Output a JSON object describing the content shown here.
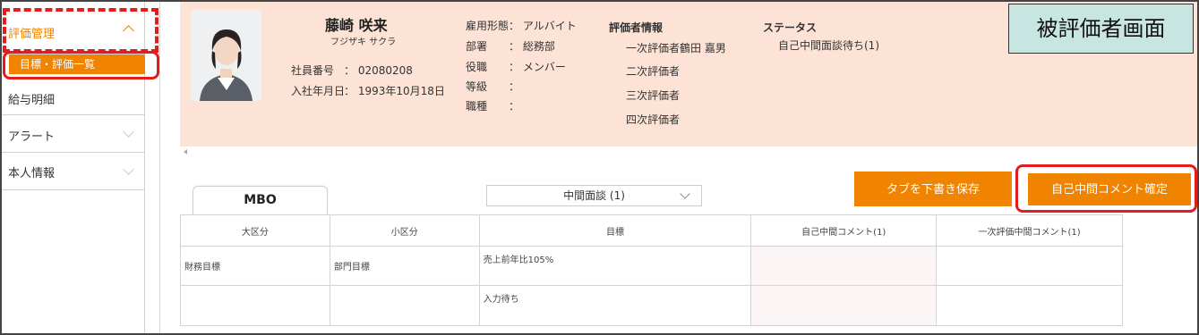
{
  "sidebar": {
    "items": [
      {
        "label": "評価管理"
      },
      {
        "label": "給与明細"
      },
      {
        "label": "アラート"
      },
      {
        "label": "本人情報"
      }
    ],
    "active_sub": "目標・評価一覧"
  },
  "profile": {
    "name": "藤崎 咲来",
    "kana": "フジザキ サクラ",
    "employee_number_label": "社員番号",
    "employee_number": "： 02080208",
    "hire_date_label": "入社年月日",
    "hire_date": "： 1993年10月18日",
    "details": [
      {
        "label": "雇用形態",
        "value": "： アルバイト"
      },
      {
        "label": "部署",
        "value": "： 総務部"
      },
      {
        "label": "役職",
        "value": "： メンバー"
      },
      {
        "label": "等級",
        "value": "："
      },
      {
        "label": "職種",
        "value": "："
      }
    ]
  },
  "evaluators": {
    "title": "評価者情報",
    "items": [
      {
        "label": "一次評価者",
        "value": "鶴田 嘉男"
      },
      {
        "label": "二次評価者",
        "value": ""
      },
      {
        "label": "三次評価者",
        "value": ""
      },
      {
        "label": "四次評価者",
        "value": ""
      }
    ]
  },
  "status": {
    "title": "ステータス",
    "value": "自己中間面談待ち(1)"
  },
  "screen_label": "被評価者画面",
  "tab": {
    "label": "MBO"
  },
  "phase_select": {
    "value": "中間面談 (1)"
  },
  "buttons": {
    "save_draft": "タブを下書き保存",
    "confirm": "自己中間コメント確定"
  },
  "table": {
    "headers": [
      "大区分",
      "小区分",
      "目標",
      "自己中間コメント(1)",
      "一次評価中間コメント(1)"
    ],
    "rows": [
      [
        "財務目標",
        "部門目標",
        "売上前年比105%",
        "",
        ""
      ],
      [
        "",
        "",
        "入力待ち",
        "",
        ""
      ]
    ]
  },
  "colors": {
    "accent": "#f08300",
    "header_bg": "#fce3d6",
    "label_bg": "#c8e6e1",
    "annotation": "#e21d1d"
  }
}
